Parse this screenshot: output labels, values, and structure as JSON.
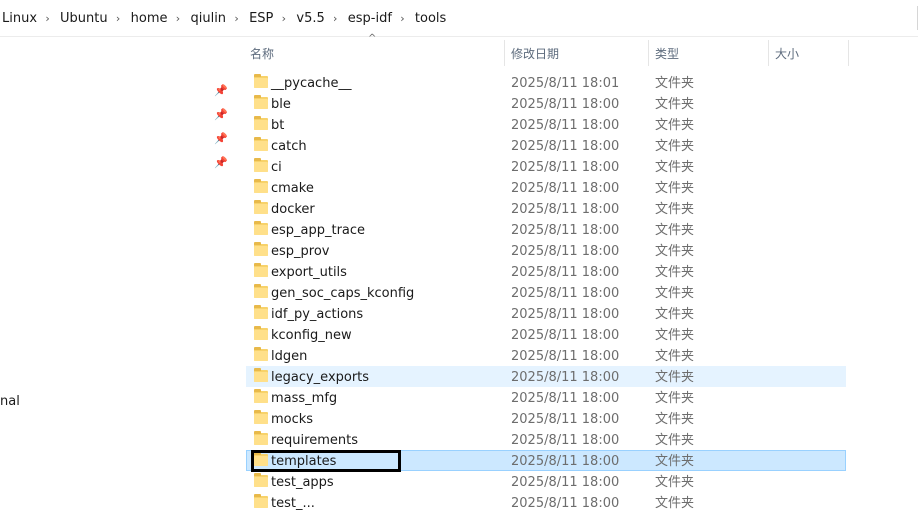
{
  "breadcrumb": [
    "Linux",
    "Ubuntu",
    "home",
    "qiulin",
    "ESP",
    "v5.5",
    "esp-idf",
    "tools"
  ],
  "breadcrumb_separator": "›",
  "nav": {
    "partial_label": "nal"
  },
  "columns": {
    "name": "名称",
    "modified": "修改日期",
    "type": "类型",
    "size": "大小",
    "sort_indicator": "^"
  },
  "files": [
    {
      "name": "__pycache__",
      "date": "2025/8/11 18:01",
      "type": "文件夹"
    },
    {
      "name": "ble",
      "date": "2025/8/11 18:00",
      "type": "文件夹"
    },
    {
      "name": "bt",
      "date": "2025/8/11 18:00",
      "type": "文件夹"
    },
    {
      "name": "catch",
      "date": "2025/8/11 18:00",
      "type": "文件夹"
    },
    {
      "name": "ci",
      "date": "2025/8/11 18:00",
      "type": "文件夹"
    },
    {
      "name": "cmake",
      "date": "2025/8/11 18:00",
      "type": "文件夹"
    },
    {
      "name": "docker",
      "date": "2025/8/11 18:00",
      "type": "文件夹"
    },
    {
      "name": "esp_app_trace",
      "date": "2025/8/11 18:00",
      "type": "文件夹"
    },
    {
      "name": "esp_prov",
      "date": "2025/8/11 18:00",
      "type": "文件夹"
    },
    {
      "name": "export_utils",
      "date": "2025/8/11 18:00",
      "type": "文件夹"
    },
    {
      "name": "gen_soc_caps_kconfig",
      "date": "2025/8/11 18:00",
      "type": "文件夹"
    },
    {
      "name": "idf_py_actions",
      "date": "2025/8/11 18:00",
      "type": "文件夹"
    },
    {
      "name": "kconfig_new",
      "date": "2025/8/11 18:00",
      "type": "文件夹"
    },
    {
      "name": "ldgen",
      "date": "2025/8/11 18:00",
      "type": "文件夹"
    },
    {
      "name": "legacy_exports",
      "date": "2025/8/11 18:00",
      "type": "文件夹",
      "state": "hover"
    },
    {
      "name": "mass_mfg",
      "date": "2025/8/11 18:00",
      "type": "文件夹"
    },
    {
      "name": "mocks",
      "date": "2025/8/11 18:00",
      "type": "文件夹"
    },
    {
      "name": "requirements",
      "date": "2025/8/11 18:00",
      "type": "文件夹"
    },
    {
      "name": "templates",
      "date": "2025/8/11 18:00",
      "type": "文件夹",
      "state": "selected"
    },
    {
      "name": "test_apps",
      "date": "2025/8/11 18:00",
      "type": "文件夹"
    },
    {
      "name": "test_...",
      "date": "2025/8/11 18:00",
      "type": "文件夹"
    }
  ]
}
